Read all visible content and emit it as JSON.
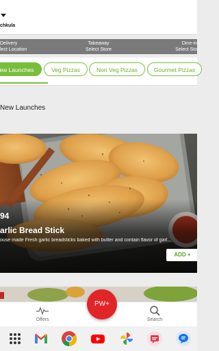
{
  "header": {
    "city": "chkula"
  },
  "order_modes": [
    {
      "title": "Delivery",
      "subtitle": "lect Location"
    },
    {
      "title": "Takeaway",
      "subtitle": "Select Store"
    },
    {
      "title": "Dine-in",
      "subtitle": "Select Sto"
    }
  ],
  "categories": [
    "ew Launches",
    "Veg Pizzas",
    "Non Veg Pizzas",
    "Gourmet Pizzas"
  ],
  "section": {
    "title": "New Launches"
  },
  "product": {
    "corner_text": "r",
    "price": "94",
    "name": "arlic Bread Stick",
    "description": "ouse made Fresh garlic breadsticks baked with butter and contain flavor of garl...",
    "add_label": "ADD +"
  },
  "bottom_nav": {
    "offers_label": "Offers",
    "center_label": "PW+",
    "search_label": "Search"
  },
  "dock": {
    "apps": [
      "app-drawer-icon",
      "gmail-icon",
      "chrome-icon",
      "youtube-icon",
      "photos-icon",
      "messages-icon",
      "chat-icon"
    ]
  },
  "colors": {
    "accent_green": "#79bd3c",
    "brand_red": "#e12428",
    "mode_strip": "#7a7a7a"
  }
}
